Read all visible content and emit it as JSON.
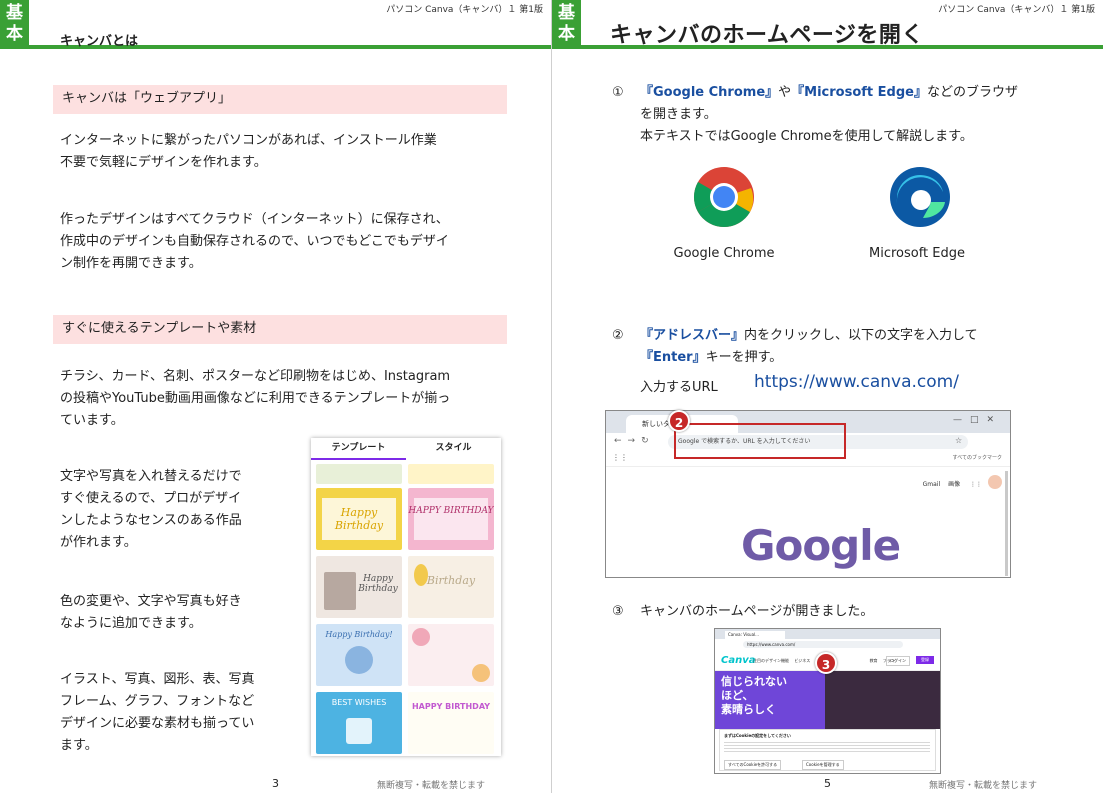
{
  "running_header": "パソコン Canva（キャンバ）１ 第1版",
  "badge": [
    "基",
    "本"
  ],
  "footer_note": "無断複写・転載を禁じます",
  "left_page": {
    "heading": "キャンバとは",
    "section1_title": "キャンバは「ウェブアプリ」",
    "para1": [
      "インターネットに繋がったパソコンがあれば、インストール作業",
      "不要で気軽にデザインを作れます。"
    ],
    "para2": [
      "作ったデザインはすべてクラウド（インターネット）に保存され、",
      "作成中のデザインも自動保存されるので、いつでもどこでもデザイ",
      "ン制作を再開できます。"
    ],
    "section2_title": "すぐに使えるテンプレートや素材",
    "para3": [
      "チラシ、カード、名刺、ポスターなど印刷物をはじめ、Instagram",
      "の投稿やYouTube動画用画像などに利用できるテンプレートが揃っ",
      "ています。"
    ],
    "para4": [
      "文字や写真を入れ替えるだけで",
      "すぐ使えるので、プロがデザイ",
      "ンしたようなセンスのある作品",
      "が作れます。"
    ],
    "para5": [
      "色の変更や、文字や写真も好き",
      "なように追加できます。"
    ],
    "para6": [
      "イラスト、写真、図形、表、写真",
      "フレーム、グラフ、フォントなど",
      "デザインに必要な素材も揃ってい",
      "ます。"
    ],
    "page_number": "3",
    "template_panel": {
      "tabs": [
        "テンプレート",
        "スタイル"
      ],
      "cards": [
        "Happy Birthday",
        "HAPPY BIRTHDAY",
        "Happy Birthday",
        "Birthday",
        "Happy Birthday!",
        "",
        "BEST WISHES",
        "HAPPY BIRTHDAY"
      ]
    }
  },
  "right_page": {
    "heading": "キャンバのホームページを開く",
    "step1": {
      "num": "①",
      "chrome": "『Google Chrome』",
      "ya": "や",
      "edge": "『Microsoft Edge』",
      "rest1": "などのブラウザ",
      "line2": "を開きます。",
      "line3": "本テキストではGoogle Chromeを使用して解説します。"
    },
    "browsers": [
      "Google Chrome",
      "Microsoft Edge"
    ],
    "step2": {
      "num": "②",
      "addr": "『アドレスバー』",
      "rest1": "内をクリックし、以下の文字を入力して",
      "enter": "『Enter』",
      "rest2": "キーを押す。",
      "url_label": "入力するURL",
      "url": "https://www.canva.com/"
    },
    "screenshot1": {
      "tab_label": "新しいタブ",
      "address_placeholder": "Google で検索するか、URL を入力してください",
      "bookmarks": "すべてのブックマーク",
      "gmail": "Gmail",
      "images": "画像",
      "logo": "Google",
      "marker": "2"
    },
    "step3": {
      "num": "③",
      "text": "キャンバのホームページが開きました。"
    },
    "screenshot2": {
      "tab_label": "Canva: Visual...",
      "url": "https://www.canva.com/",
      "logo": "Canva",
      "nav": [
        "注目のデザイン機能",
        "ビジネス",
        "教育",
        "プラン"
      ],
      "hero": [
        "信じられない",
        "ほど、",
        "素晴らしく"
      ],
      "cookie_title": "まずはCookieの設定をしてください",
      "cookie_buttons": [
        "すべてのCookieを許可する",
        "Cookieを管理する"
      ],
      "login": "ログイン",
      "signup": "登録",
      "marker": "3"
    },
    "page_number": "5"
  },
  "colors": {
    "accent_green": "#3aa035",
    "pink_band": "#fde0e0",
    "link_blue": "#1a4fa0",
    "marker_red": "#c62828",
    "canva_purple": "#7d2ae8"
  }
}
